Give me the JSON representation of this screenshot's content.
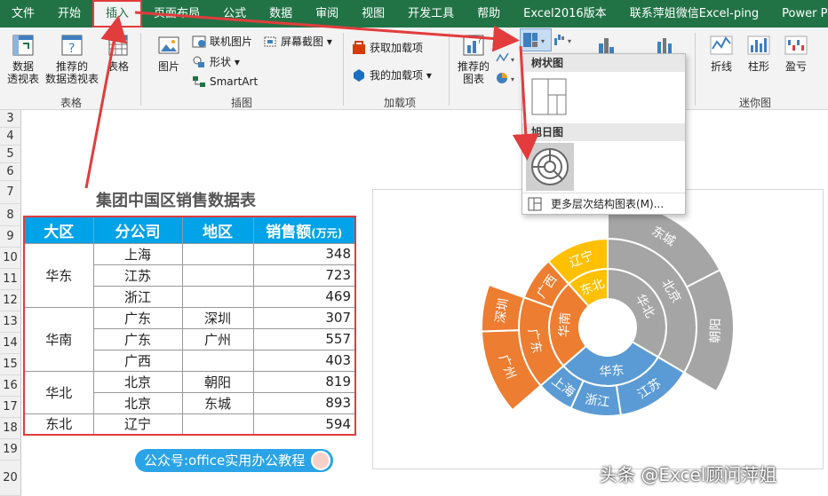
{
  "menu": [
    "文件",
    "开始",
    "插入",
    "页面布局",
    "公式",
    "数据",
    "审阅",
    "视图",
    "开发工具",
    "帮助",
    "Excel2016版本",
    "联系萍姐微信Excel-ping",
    "Power Pivot"
  ],
  "ribbon": {
    "pivot_label": "数据\n透视表",
    "rec_pivot_label": "推荐的\n数据透视表",
    "table_label": "表格",
    "group_table": "表格",
    "picture_label": "图片",
    "online_pic": "联机图片",
    "shapes": "形状",
    "smartart": "SmartArt",
    "screenshot": "屏幕截图",
    "group_illus": "插图",
    "get_addins": "获取加载项",
    "my_addins": "我的加载项",
    "group_addins": "加载项",
    "rec_chart": "推荐的\n图表",
    "spark_line": "折线",
    "spark_col": "柱形",
    "spark_wl": "盈亏",
    "group_spark": "迷你图"
  },
  "dropdown": {
    "treemap": "树状图",
    "sunburst": "旭日图",
    "more": "更多层次结构图表(M)..."
  },
  "rows": [
    "3",
    "4",
    "5",
    "6",
    "7",
    "8",
    "9",
    "10",
    "11",
    "12",
    "13",
    "14",
    "15",
    "16",
    "17",
    "18",
    "19",
    "20"
  ],
  "sheet": {
    "title": "集团中国区销售数据表",
    "headers": [
      "大区",
      "分公司",
      "地区",
      "销售额"
    ],
    "unit": "(万元)",
    "regions": [
      {
        "name": "华东",
        "rows": [
          [
            "上海",
            "",
            "348"
          ],
          [
            "江苏",
            "",
            "723"
          ],
          [
            "浙江",
            "",
            "469"
          ]
        ]
      },
      {
        "name": "华南",
        "rows": [
          [
            "广东",
            "深圳",
            "307"
          ],
          [
            "广东",
            "广州",
            "557"
          ],
          [
            "广西",
            "",
            "403"
          ]
        ]
      },
      {
        "name": "华北",
        "rows": [
          [
            "北京",
            "朝阳",
            "819"
          ],
          [
            "北京",
            "东城",
            "893"
          ]
        ]
      },
      {
        "name": "东北",
        "rows": [
          [
            "辽宁",
            "",
            "594"
          ]
        ]
      }
    ]
  },
  "chart_data": {
    "type": "sunburst",
    "rings": {
      "inner": [
        {
          "label": "华北",
          "value": 1712,
          "color": "#a5a5a5"
        },
        {
          "label": "华东",
          "value": 1540,
          "color": "#5b9bd5"
        },
        {
          "label": "华南",
          "value": 1267,
          "color": "#ed7d31"
        },
        {
          "label": "东北",
          "value": 594,
          "color": "#ffc000"
        }
      ],
      "middle": [
        {
          "label": "北京",
          "value": 1712,
          "color": "#a5a5a5"
        },
        {
          "label": "江苏",
          "value": 723,
          "color": "#5b9bd5"
        },
        {
          "label": "浙江",
          "value": 469,
          "color": "#5b9bd5"
        },
        {
          "label": "上海",
          "value": 348,
          "color": "#5b9bd5"
        },
        {
          "label": "广东",
          "value": 864,
          "color": "#ed7d31"
        },
        {
          "label": "广西",
          "value": 403,
          "color": "#ed7d31"
        },
        {
          "label": "辽宁",
          "value": 594,
          "color": "#ffc000"
        }
      ],
      "outer": [
        {
          "label": "东城",
          "value": 893,
          "color": "#a5a5a5",
          "start": 0
        },
        {
          "label": "朝阳",
          "value": 819,
          "color": "#a5a5a5",
          "start": 893
        },
        {
          "label": "广州",
          "value": 557,
          "color": "#ed7d31",
          "start": 3252
        },
        {
          "label": "深圳",
          "value": 307,
          "color": "#ed7d31",
          "start": 3809
        }
      ]
    },
    "total": 5113
  },
  "badge": "公众号:office实用办公教程",
  "watermark": "头条 @Excel顾问萍姐"
}
